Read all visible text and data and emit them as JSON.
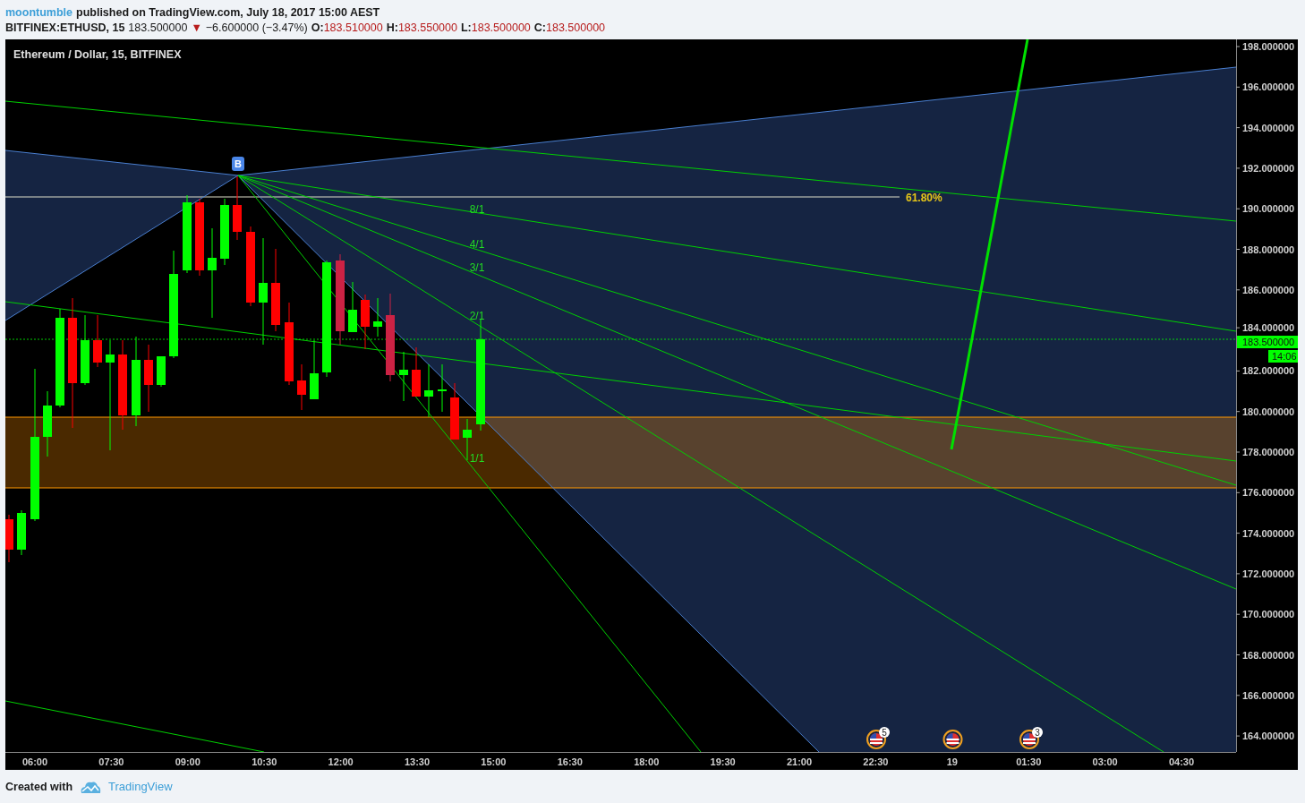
{
  "header": {
    "author": "moontumble",
    "published": "published on TradingView.com, July 18, 2017 15:00 AEST",
    "symbol": "BITFINEX:ETHUSD, 15",
    "last": "183.500000",
    "direction": "▼",
    "change": "−6.600000 (−3.47%)",
    "ohlc": [
      {
        "key": "O:",
        "value": "183.510000"
      },
      {
        "key": "H:",
        "value": "183.550000"
      },
      {
        "key": "L:",
        "value": "183.500000"
      },
      {
        "key": "C:",
        "value": "183.500000"
      }
    ]
  },
  "chart": {
    "title": "Ethereum / Dollar, 15, BITFINEX",
    "pivot_marker": "B",
    "fib_level": "61.80%",
    "fan_labels": [
      "8/1",
      "4/1",
      "3/1",
      "2/1",
      "1/1"
    ],
    "price_axis": [
      "198.000000",
      "196.000000",
      "194.000000",
      "192.000000",
      "190.000000",
      "188.000000",
      "186.000000",
      "184.000000",
      "182.000000",
      "180.000000",
      "178.000000",
      "176.000000",
      "174.000000",
      "172.000000",
      "170.000000",
      "168.000000",
      "166.000000",
      "164.000000"
    ],
    "last_price": "183.500000",
    "countdown": "14:06",
    "time_axis": [
      "06:00",
      "07:30",
      "09:00",
      "10:30",
      "12:00",
      "13:30",
      "15:00",
      "16:30",
      "18:00",
      "19:30",
      "21:00",
      "22:30",
      "19",
      "01:30",
      "03:00",
      "04:30"
    ],
    "events": [
      {
        "kind": "flag",
        "badge": "5"
      },
      {
        "kind": "flag"
      },
      {
        "kind": "flag",
        "badge": "3"
      }
    ]
  },
  "footer": {
    "text": "Created with",
    "brand": "TradingView"
  }
}
